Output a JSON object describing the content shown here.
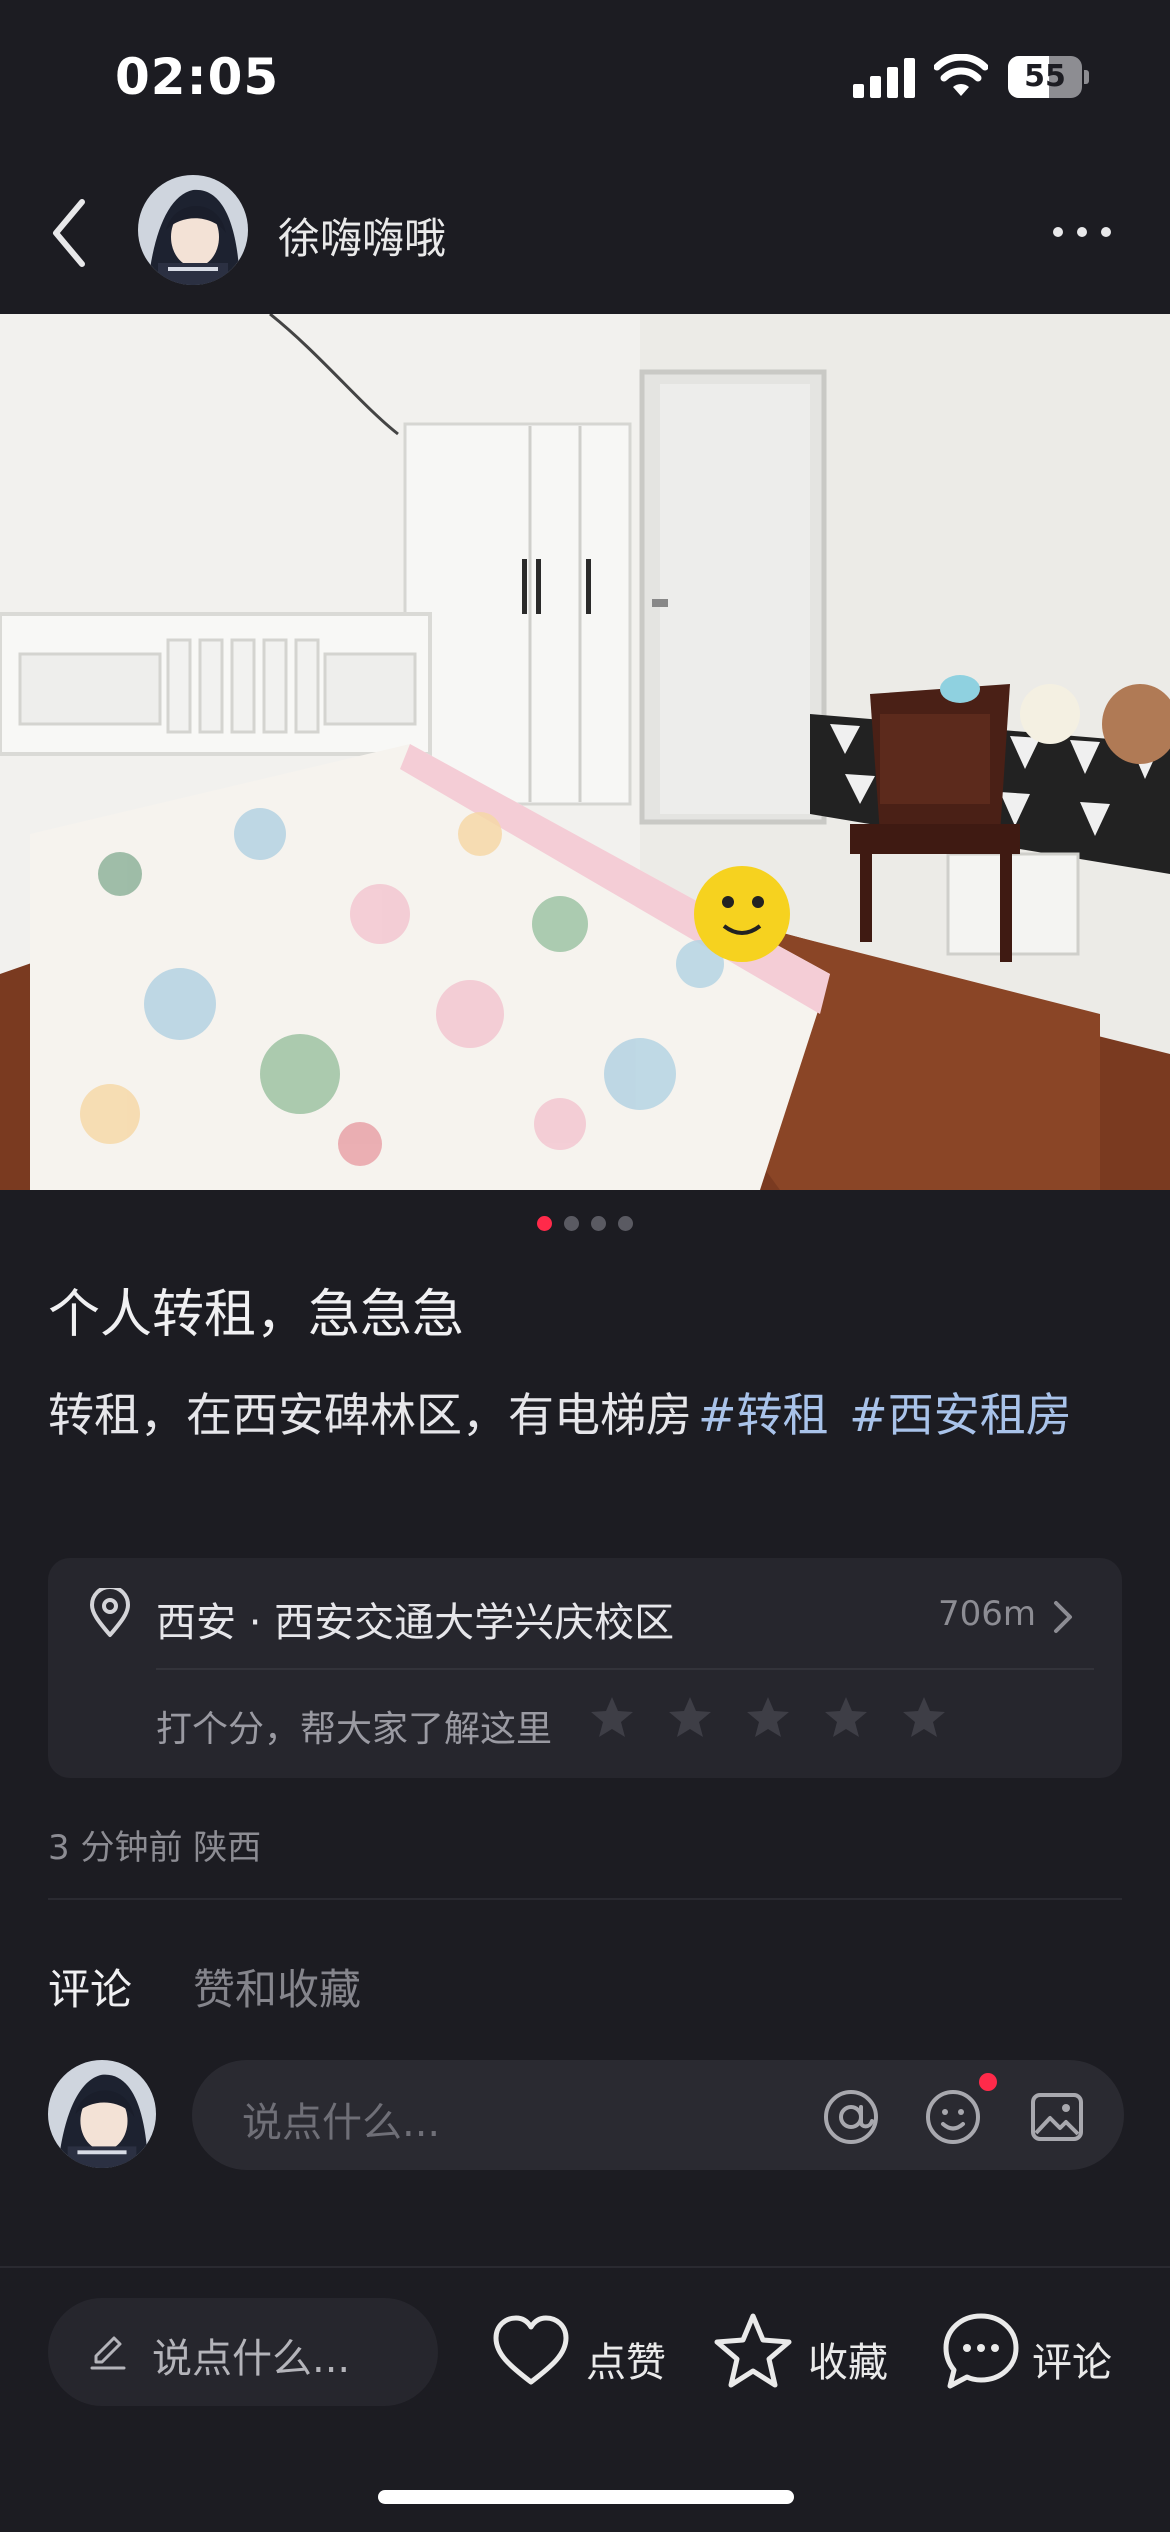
{
  "status_bar": {
    "time": "02:05",
    "battery_level": "55",
    "icons": [
      "signal-icon",
      "wifi-icon",
      "battery-icon"
    ]
  },
  "header": {
    "author_name": "徐嗨嗨哦",
    "icons": [
      "back-icon",
      "more-icon"
    ]
  },
  "photo": {
    "page_count": 4,
    "active_page": 1
  },
  "post": {
    "title": "个人转租，急急急",
    "body": "转租，在西安碑林区，有电梯房",
    "tags": [
      "#转租",
      "#西安租房"
    ]
  },
  "location": {
    "name": "西安 · 西安交通大学兴庆校区",
    "distance": "706m",
    "rating_prompt": "打个分，帮大家了解这里",
    "star_count": 5,
    "rating": 0
  },
  "meta": {
    "time_place": "3 分钟前 陕西"
  },
  "tabs": {
    "comments": "评论",
    "likes": "赞和收藏"
  },
  "comment_box": {
    "placeholder": "说点什么..."
  },
  "bottom_bar": {
    "input_label": "说点什么...",
    "like_label": "点赞",
    "favorite_label": "收藏",
    "comment_label": "评论"
  },
  "colors": {
    "background": "#1c1c22",
    "accent": "#ff2a4a",
    "tag": "#a9c3ea"
  }
}
